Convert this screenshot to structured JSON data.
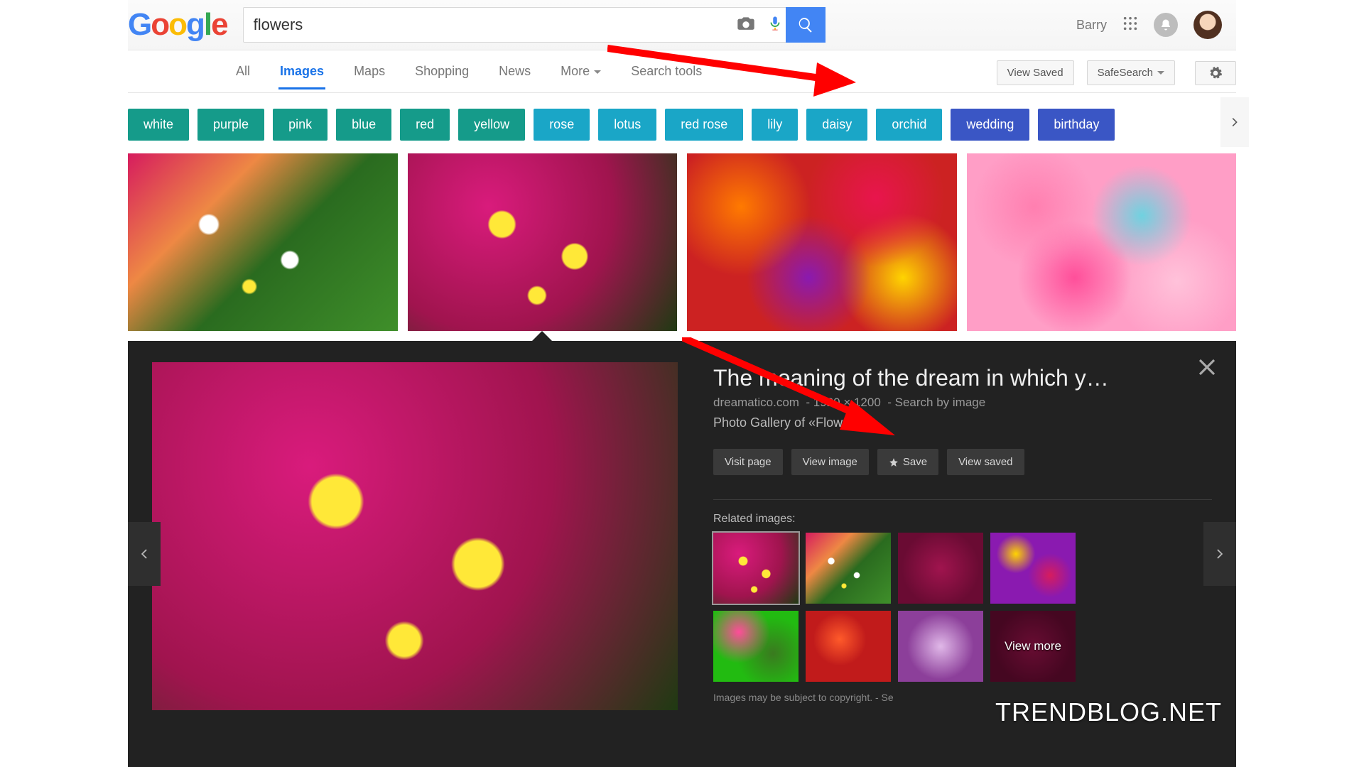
{
  "header": {
    "search_value": "flowers",
    "user_name": "Barry"
  },
  "nav": {
    "items": [
      "All",
      "Images",
      "Maps",
      "Shopping",
      "News",
      "More",
      "Search tools"
    ],
    "active_index": 1,
    "view_saved": "View Saved",
    "safesearch": "SafeSearch"
  },
  "chips": [
    {
      "label": "white",
      "variant": "teal"
    },
    {
      "label": "purple",
      "variant": "teal"
    },
    {
      "label": "pink",
      "variant": "teal"
    },
    {
      "label": "blue",
      "variant": "teal"
    },
    {
      "label": "red",
      "variant": "teal"
    },
    {
      "label": "yellow",
      "variant": "teal"
    },
    {
      "label": "rose",
      "variant": "cyan"
    },
    {
      "label": "lotus",
      "variant": "cyan"
    },
    {
      "label": "red rose",
      "variant": "cyan"
    },
    {
      "label": "lily",
      "variant": "cyan"
    },
    {
      "label": "daisy",
      "variant": "cyan"
    },
    {
      "label": "orchid",
      "variant": "cyan"
    },
    {
      "label": "wedding",
      "variant": "blue"
    },
    {
      "label": "birthday",
      "variant": "blue"
    }
  ],
  "detail": {
    "title": "The meaning of the dream in which y…",
    "source": "dreamatico.com",
    "dimensions": "1920 × 1200",
    "search_by_image": "Search by image",
    "description": "Photo Gallery of «Flowers»",
    "buttons": {
      "visit": "Visit page",
      "view_image": "View image",
      "save": "Save",
      "view_saved": "View saved"
    },
    "related_label": "Related images:",
    "view_more": "View more",
    "copyright": "Images may be subject to copyright. - Se"
  },
  "watermark": "TRENDBLOG.NET"
}
